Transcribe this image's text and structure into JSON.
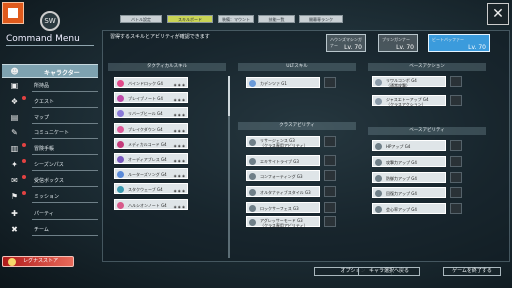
{
  "header": {
    "title": "Command Menu",
    "close": "✕",
    "emblem": "SW",
    "tabs": [
      "バトル設定",
      "スキルボード",
      "装備：マウント",
      "技能一覧",
      "開幕専ランク"
    ],
    "active_tab": 1
  },
  "sidebar": {
    "items": [
      {
        "label": "キャラクター",
        "icon": "person-icon",
        "active": true
      },
      {
        "label": "所持品",
        "icon": "bag-icon"
      },
      {
        "label": "クエスト",
        "icon": "quest-icon",
        "badge": true
      },
      {
        "label": "マップ",
        "icon": "map-icon"
      },
      {
        "label": "コミュニケート",
        "icon": "chat-icon"
      },
      {
        "label": "冒険手帳",
        "icon": "book-icon",
        "badge": true
      },
      {
        "label": "シーズンパス",
        "icon": "pass-icon",
        "badge": true
      },
      {
        "label": "受信ボックス",
        "icon": "mail-icon",
        "badge": true
      },
      {
        "label": "ミッション",
        "icon": "flag-icon",
        "badge": true
      },
      {
        "label": "パーティ",
        "icon": "party-icon"
      },
      {
        "label": "チーム",
        "icon": "team-icon"
      }
    ],
    "store": "レグナスストア"
  },
  "notice": "習得するスキルとアビリティが確認できます",
  "class_cards": [
    {
      "name": "ハウンズマシンガナー",
      "lv": "Lv. 70"
    },
    {
      "name": "ブリンガンナー",
      "lv": "Lv. 70"
    },
    {
      "name": "ビートバッファー",
      "lv": "Lv. 70",
      "active": true
    }
  ],
  "sections": {
    "tactical": "タクティカルスキル",
    "ult": "ULTスキル",
    "base_action": "ベースアクション",
    "class_ability": "クラスアビリティ",
    "base_ability": "ベースアビリティ"
  },
  "tactical_skills": [
    {
      "name": "バインドロック G4",
      "color": "#e24a8a",
      "marks": "◉ ◉ ◉"
    },
    {
      "name": "ブレイブノート G4",
      "color": "#c04aa8",
      "marks": "◉ ◉ ◉"
    },
    {
      "name": "リバーブヒール G4",
      "color": "#8a7ad8",
      "marks": "◉ ◉ ◉"
    },
    {
      "name": "ブレイクダウン G4",
      "color": "#e05a9a",
      "marks": "◉ ◉ ◉"
    },
    {
      "name": "メディカルコード G4",
      "color": "#c43a7a",
      "marks": "◉ ◉ ◉"
    },
    {
      "name": "オーディアブレス G4",
      "color": "#7a5ac0",
      "marks": "◉ ◉ ◉"
    },
    {
      "name": "ルーターズソング G4",
      "color": "#5a8ad8",
      "marks": "◉ ◉ ◉"
    },
    {
      "name": "スタクウェーブ G4",
      "color": "#3a9ab0",
      "marks": "◉ ◉ ◉"
    },
    {
      "name": "ハルシオンノート G4",
      "color": "#d85a8a",
      "marks": "◉ ◉ ◉"
    }
  ],
  "ult_skills": [
    {
      "name": "カデンツァ G1",
      "color": "#6a9ad8"
    }
  ],
  "base_actions": [
    {
      "name": "リワルコンボ G4",
      "sub": "（通常攻撃）",
      "color": "#8a9aa8"
    },
    {
      "name": "ジャスエトーアップ G4",
      "sub": "（クラスアクション）",
      "color": "#8a9aa8"
    }
  ],
  "class_abilities": [
    {
      "name": "リサージェンス G3",
      "sub": "（クラス専用アビリティ）"
    },
    {
      "name": "エキサイトライブ G3"
    },
    {
      "name": "コンフォーティング G3"
    },
    {
      "name": "オルタナティブスタイル G3"
    },
    {
      "name": "ロックサーフェス G3"
    },
    {
      "name": "アグレッサーモード G3",
      "sub": "（クラス専用アビリティ）"
    }
  ],
  "base_abilities": [
    "HPアップ G4",
    "攻撃力アップ G4",
    "防御力アップ G4",
    "回復力アップ G4",
    "会心率アップ G4"
  ],
  "bottom": {
    "option": "オプション",
    "switch": "キャラ選択へ戻る",
    "quit": "ゲームを終了する"
  },
  "colors": {
    "accent": "#3b9bdc",
    "active_tab": "#c9d455",
    "store": "#b01a1a"
  }
}
